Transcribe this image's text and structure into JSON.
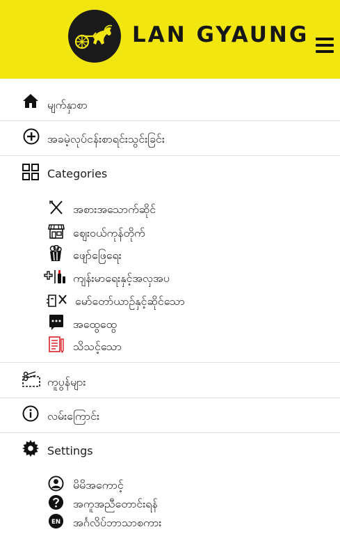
{
  "header": {
    "brand": "LAN GYAUNG",
    "bg_color": "#f1e60f",
    "menu_icon": "hamburger-icon"
  },
  "menu": {
    "home": {
      "label": "မျက်နှာစာ",
      "icon": "home-icon"
    },
    "add_listing": {
      "label": "အခမဲ့လုပ်ငန်းစာရင်းသွင်းခြင်း",
      "icon": "plus-circle-icon"
    },
    "categories": {
      "label": "Categories",
      "icon": "grid-icon"
    },
    "category_items": [
      {
        "label": "အစားအသောက်ဆိုင်",
        "icon": "utensils-icon"
      },
      {
        "label": "ဈေးဝယ်ကုန်တိုက်",
        "icon": "store-icon"
      },
      {
        "label": "ဖျော်ဖြေရေး",
        "icon": "popcorn-icon"
      },
      {
        "label": "ကျန်းမာရေးနှင့်အလှအပ",
        "icon": "health-beauty-icon"
      },
      {
        "label": "မော်တော်ယာဥ်နှင့်ဆိုင်သော",
        "icon": "car-tools-icon"
      },
      {
        "label": "အထွေထွေ",
        "icon": "chat-dots-icon"
      },
      {
        "label": "သိသင့်သော",
        "icon": "document-icon"
      }
    ],
    "coupons": {
      "label": "ကူပွန်များ",
      "icon": "coupon-scissors-icon"
    },
    "about": {
      "label": "လမ်းကြောင်း",
      "icon": "info-icon"
    },
    "settings": {
      "label": "Settings",
      "icon": "gear-icon"
    },
    "settings_items": [
      {
        "label": "မိမိအကောင့်",
        "icon": "user-account-icon"
      },
      {
        "label": "အကူအညီတောင်းရန်",
        "icon": "help-icon"
      },
      {
        "label": "အင်္ဂလိပ်ဘာသာစကား",
        "icon": "language-en-icon",
        "badge": "EN"
      }
    ],
    "accent_red": "#d81f26"
  }
}
